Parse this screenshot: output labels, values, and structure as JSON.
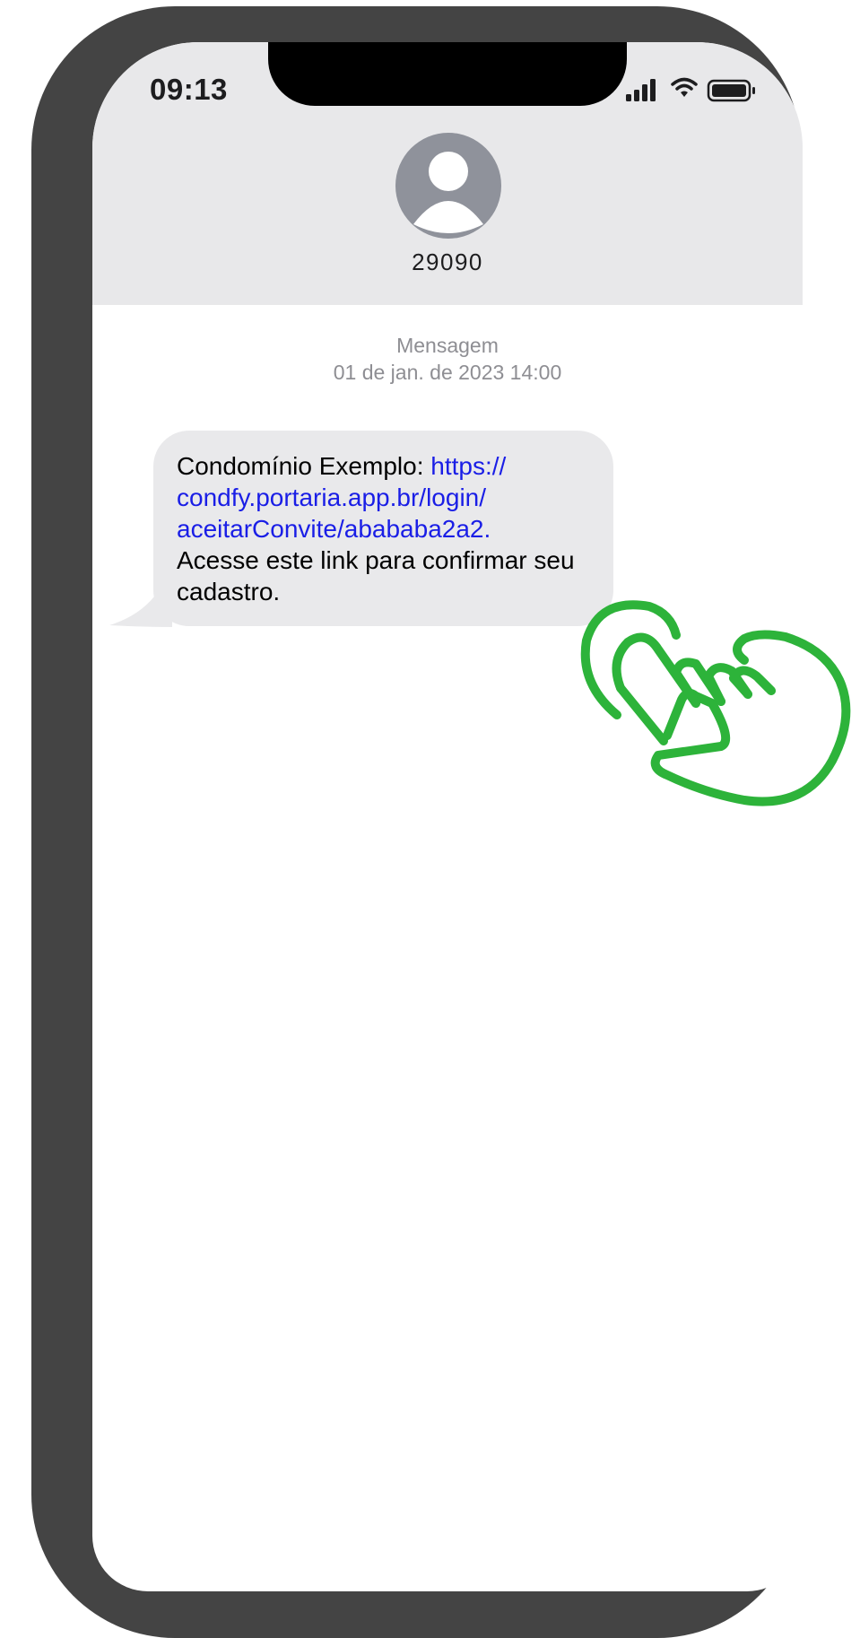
{
  "status_bar": {
    "time": "09:13",
    "icons": [
      "signal-icon",
      "wifi-icon",
      "battery-icon"
    ]
  },
  "conversation": {
    "contact": "29090",
    "avatar_icon": "person-avatar-icon",
    "meta_label": "Mensagem",
    "meta_date": "01 de jan. de 2023 14:00"
  },
  "message": {
    "prefix": "Condomínio Exemplo: ",
    "link_line1": "https://",
    "link_line2": "condfy.portaria.app.br/login/",
    "link_line3": "aceitarConvite/abababa2a2.",
    "suffix": "Acesse este link para confirmar seu cadastro."
  },
  "overlay": {
    "gesture_icon": "tap-hand-icon",
    "accent_color": "#2db33a"
  },
  "colors": {
    "frame": "#444444",
    "header": "#e8e8ea",
    "bubble": "#e9e9eb",
    "link": "#1a1ee6",
    "meta_text": "#8e8e93"
  }
}
